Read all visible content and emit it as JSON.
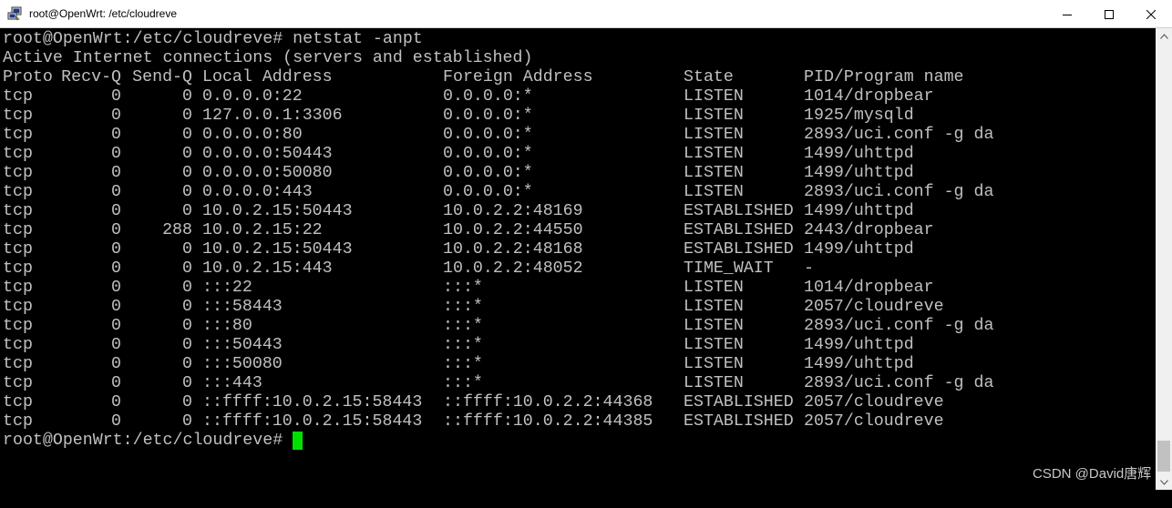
{
  "window": {
    "title": "root@OpenWrt: /etc/cloudreve",
    "icons": {
      "app": "putty-icon",
      "minimize": "minimize-icon",
      "maximize": "maximize-icon",
      "close": "close-icon"
    }
  },
  "terminal": {
    "command_line": "root@OpenWrt:/etc/cloudreve# netstat -anpt",
    "info_line": "Active Internet connections (servers and established)",
    "header": {
      "proto": "Proto",
      "recv_q": "Recv-Q",
      "send_q": "Send-Q",
      "local": "Local Address",
      "foreign": "Foreign Address",
      "state": "State",
      "pid": "PID/Program name"
    },
    "rows": [
      {
        "proto": "tcp",
        "recv_q": "0",
        "send_q": "0",
        "local": "0.0.0.0:22",
        "foreign": "0.0.0.0:*",
        "state": "LISTEN",
        "pid": "1014/dropbear"
      },
      {
        "proto": "tcp",
        "recv_q": "0",
        "send_q": "0",
        "local": "127.0.0.1:3306",
        "foreign": "0.0.0.0:*",
        "state": "LISTEN",
        "pid": "1925/mysqld"
      },
      {
        "proto": "tcp",
        "recv_q": "0",
        "send_q": "0",
        "local": "0.0.0.0:80",
        "foreign": "0.0.0.0:*",
        "state": "LISTEN",
        "pid": "2893/uci.conf -g da"
      },
      {
        "proto": "tcp",
        "recv_q": "0",
        "send_q": "0",
        "local": "0.0.0.0:50443",
        "foreign": "0.0.0.0:*",
        "state": "LISTEN",
        "pid": "1499/uhttpd"
      },
      {
        "proto": "tcp",
        "recv_q": "0",
        "send_q": "0",
        "local": "0.0.0.0:50080",
        "foreign": "0.0.0.0:*",
        "state": "LISTEN",
        "pid": "1499/uhttpd"
      },
      {
        "proto": "tcp",
        "recv_q": "0",
        "send_q": "0",
        "local": "0.0.0.0:443",
        "foreign": "0.0.0.0:*",
        "state": "LISTEN",
        "pid": "2893/uci.conf -g da"
      },
      {
        "proto": "tcp",
        "recv_q": "0",
        "send_q": "0",
        "local": "10.0.2.15:50443",
        "foreign": "10.0.2.2:48169",
        "state": "ESTABLISHED",
        "pid": "1499/uhttpd"
      },
      {
        "proto": "tcp",
        "recv_q": "0",
        "send_q": "288",
        "local": "10.0.2.15:22",
        "foreign": "10.0.2.2:44550",
        "state": "ESTABLISHED",
        "pid": "2443/dropbear"
      },
      {
        "proto": "tcp",
        "recv_q": "0",
        "send_q": "0",
        "local": "10.0.2.15:50443",
        "foreign": "10.0.2.2:48168",
        "state": "ESTABLISHED",
        "pid": "1499/uhttpd"
      },
      {
        "proto": "tcp",
        "recv_q": "0",
        "send_q": "0",
        "local": "10.0.2.15:443",
        "foreign": "10.0.2.2:48052",
        "state": "TIME_WAIT",
        "pid": "-"
      },
      {
        "proto": "tcp",
        "recv_q": "0",
        "send_q": "0",
        "local": ":::22",
        "foreign": ":::*",
        "state": "LISTEN",
        "pid": "1014/dropbear"
      },
      {
        "proto": "tcp",
        "recv_q": "0",
        "send_q": "0",
        "local": ":::58443",
        "foreign": ":::*",
        "state": "LISTEN",
        "pid": "2057/cloudreve"
      },
      {
        "proto": "tcp",
        "recv_q": "0",
        "send_q": "0",
        "local": ":::80",
        "foreign": ":::*",
        "state": "LISTEN",
        "pid": "2893/uci.conf -g da"
      },
      {
        "proto": "tcp",
        "recv_q": "0",
        "send_q": "0",
        "local": ":::50443",
        "foreign": ":::*",
        "state": "LISTEN",
        "pid": "1499/uhttpd"
      },
      {
        "proto": "tcp",
        "recv_q": "0",
        "send_q": "0",
        "local": ":::50080",
        "foreign": ":::*",
        "state": "LISTEN",
        "pid": "1499/uhttpd"
      },
      {
        "proto": "tcp",
        "recv_q": "0",
        "send_q": "0",
        "local": ":::443",
        "foreign": ":::*",
        "state": "LISTEN",
        "pid": "2893/uci.conf -g da"
      },
      {
        "proto": "tcp",
        "recv_q": "0",
        "send_q": "0",
        "local": "::ffff:10.0.2.15:58443",
        "foreign": "::ffff:10.0.2.2:44368",
        "state": "ESTABLISHED",
        "pid": "2057/cloudreve"
      },
      {
        "proto": "tcp",
        "recv_q": "0",
        "send_q": "0",
        "local": "::ffff:10.0.2.15:58443",
        "foreign": "::ffff:10.0.2.2:44385",
        "state": "ESTABLISHED",
        "pid": "2057/cloudreve"
      }
    ],
    "prompt": "root@OpenWrt:/etc/cloudreve#",
    "colors": {
      "background": "#000000",
      "text": "#c0c0c0",
      "cursor": "#00e000"
    }
  },
  "watermark": "CSDN @David唐辉"
}
